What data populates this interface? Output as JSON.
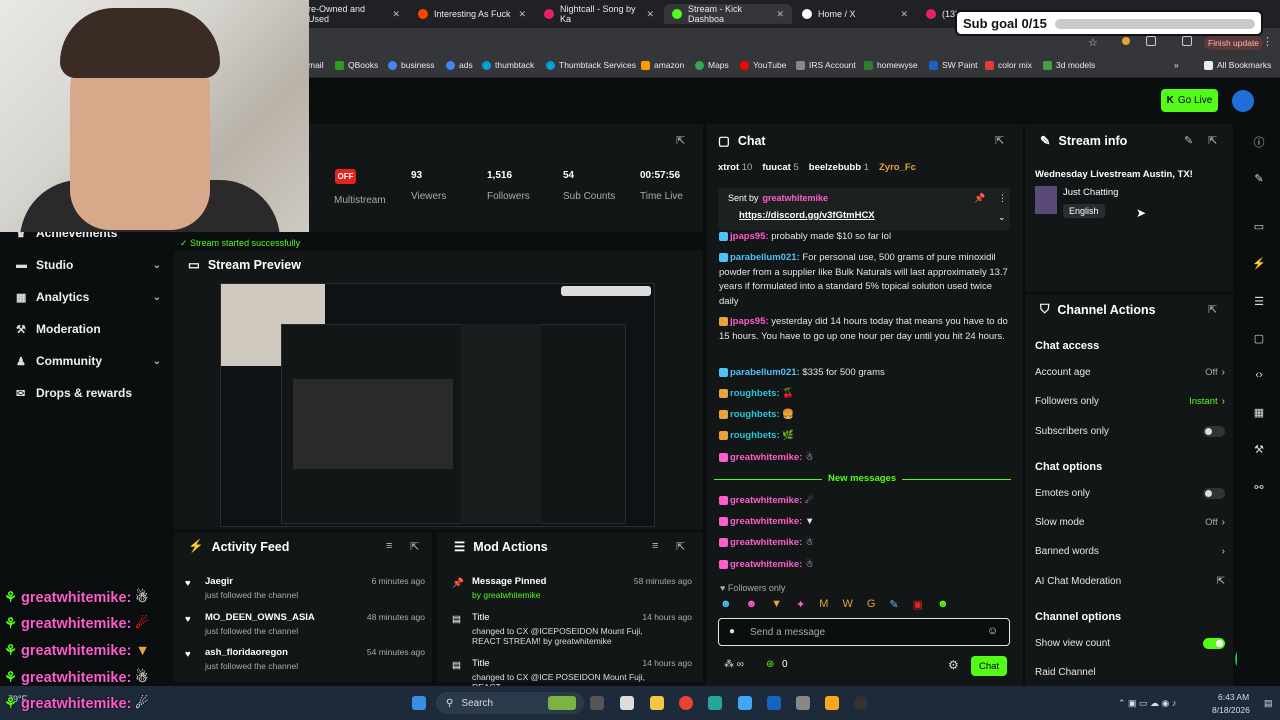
{
  "browser": {
    "tabs": [
      {
        "label": "re-Owned and Used",
        "color": "#5f6368"
      },
      {
        "label": "Interesting As Fuck",
        "color": "#ff4500"
      },
      {
        "label": "Nightcall - Song by Ka",
        "color": "#e91e63"
      },
      {
        "label": "Stream - Kick Dashboa",
        "color": "#53fc18"
      },
      {
        "label": "Home / X",
        "color": "#ffffff"
      },
      {
        "label": "(13)",
        "color": "#e91e63"
      }
    ],
    "finish_update": "Finish update",
    "bookmarks": [
      {
        "label": "mail",
        "color": "#cccccc"
      },
      {
        "label": "QBooks",
        "color": "#2ca01c"
      },
      {
        "label": "business",
        "color": "#4285f4"
      },
      {
        "label": "ads",
        "color": "#4285f4"
      },
      {
        "label": "thumbtack",
        "color": "#009fd9"
      },
      {
        "label": "Thumbtack Services",
        "color": "#009fd9"
      },
      {
        "label": "amazon",
        "color": "#ff9900"
      },
      {
        "label": "Maps",
        "color": "#34a853"
      },
      {
        "label": "YouTube",
        "color": "#ff0000"
      },
      {
        "label": "IRS Account",
        "color": "#888888"
      },
      {
        "label": "homewyse",
        "color": "#2e7d32"
      },
      {
        "label": "SW Paint",
        "color": "#1565c0"
      },
      {
        "label": "color mix",
        "color": "#e53935"
      },
      {
        "label": "3d models",
        "color": "#43a047"
      }
    ],
    "all_bookmarks": "All Bookmarks"
  },
  "header": {
    "go_live": "Go Live"
  },
  "overlay": {
    "sub_goal": "Sub goal 0/15",
    "sub_goal_progress": 0,
    "chat_lines": [
      {
        "user": "greatwhitemike:",
        "emote": "☃"
      },
      {
        "user": "greatwhitemike:",
        "emote": "☄"
      },
      {
        "user": "greatwhitemike:",
        "emote": "▼"
      },
      {
        "user": "greatwhitemike:",
        "emote": "☃"
      },
      {
        "user": "greatwhitemike:",
        "emote": "☄"
      }
    ]
  },
  "sidebar": {
    "items": [
      {
        "label": "Achievements",
        "icon": "trophy-icon",
        "has_chevron": false
      },
      {
        "label": "Studio",
        "icon": "studio-icon",
        "has_chevron": true
      },
      {
        "label": "Analytics",
        "icon": "chart-icon",
        "has_chevron": true
      },
      {
        "label": "Moderation",
        "icon": "shield-icon",
        "has_chevron": false
      },
      {
        "label": "Community",
        "icon": "people-icon",
        "has_chevron": true
      },
      {
        "label": "Drops & rewards",
        "icon": "gift-icon",
        "has_chevron": false
      }
    ],
    "toast": "Stream started successfully"
  },
  "stats": {
    "status": "OFF",
    "multistream": "Multistream",
    "items": [
      {
        "value": "93",
        "label": "Viewers"
      },
      {
        "value": "1,516",
        "label": "Followers"
      },
      {
        "value": "54",
        "label": "Sub Counts"
      },
      {
        "value": "00:57:56",
        "label": "Time Live"
      }
    ]
  },
  "preview": {
    "title": "Stream Preview"
  },
  "activity_feed": {
    "title": "Activity Feed",
    "items": [
      {
        "name": "Jaegir",
        "sub": "just followed the channel",
        "time": "6 minutes ago"
      },
      {
        "name": "MO_DEEN_OWNS_ASIA",
        "sub": "just followed the channel",
        "time": "48 minutes ago"
      },
      {
        "name": "ash_floridaoregon",
        "sub": "just followed the channel",
        "time": "54 minutes ago"
      }
    ]
  },
  "mod_actions": {
    "title": "Mod Actions",
    "items": [
      {
        "name": "Message Pinned",
        "sub": "by greatwhitemike",
        "time": "58 minutes ago"
      },
      {
        "name": "Title",
        "sub": "changed to CX @ICEPOSEIDON Mount Fuji, REACT STREAM! by greatwhitemike",
        "time": "14 hours ago"
      },
      {
        "name": "Title",
        "sub": "changed to CX @ICE POSEIDON Mount Fuji, REACT",
        "time": "14 hours ago"
      }
    ]
  },
  "chat": {
    "title": "Chat",
    "top_gifters": [
      {
        "name": "xtrot",
        "count": "10"
      },
      {
        "name": "fuucat",
        "count": "5"
      },
      {
        "name": "beelzebubb",
        "count": "1"
      },
      {
        "name": "Zyro_Fc",
        "count": ""
      }
    ],
    "pinned": {
      "sent_by_label": "Sent by",
      "user": "greatwhitemike",
      "link": "https://discord.gg/v3fGtmHCX"
    },
    "messages": [
      {
        "user": "jpaps95:",
        "text": "probably made $10 so far lol",
        "color": "pink"
      },
      {
        "user": "parabellum021:",
        "text": "For personal use, 500 grams of pure minoxidil powder from a supplier like Bulk Naturals will last approximately 13.7 years if formulated into a standard 5% topical solution used twice daily",
        "color": "blue"
      },
      {
        "user": "jpaps95:",
        "text": "yesterday did 14 hours today that means you have to do 15 hours. You have to go up one hour per day until you hit 24 hours.",
        "color": "pink"
      },
      {
        "user": "parabellum021:",
        "text": "$335 for 500 grams",
        "color": "blue"
      },
      {
        "user": "roughbets:",
        "text": "🍒",
        "color": "cyan"
      },
      {
        "user": "roughbets:",
        "text": "🍔",
        "color": "cyan"
      },
      {
        "user": "roughbets:",
        "text": "🌿",
        "color": "cyan"
      },
      {
        "user": "greatwhitemike:",
        "text": "☃",
        "color": "green"
      }
    ],
    "new_messages": "New messages",
    "new_msgs": [
      {
        "user": "greatwhitemike:",
        "text": "☄"
      },
      {
        "user": "greatwhitemike:",
        "text": "▼"
      },
      {
        "user": "greatwhitemike:",
        "text": "☃"
      },
      {
        "user": "greatwhitemike:",
        "text": "☃"
      }
    ],
    "followers_only": "Followers only",
    "send_placeholder": "Send a message",
    "points": "0",
    "chat_button": "Chat"
  },
  "stream_info": {
    "title": "Stream info",
    "stream_title": "Wednesday Livestream Austin, TX!",
    "category": "Just Chatting",
    "language": "English"
  },
  "channel_actions": {
    "title": "Channel Actions",
    "chat_access": "Chat access",
    "account_age": {
      "label": "Account age",
      "value": "Off"
    },
    "followers_only": {
      "label": "Followers only",
      "value": "Instant"
    },
    "subscribers_only": {
      "label": "Subscribers only"
    },
    "chat_options": "Chat options",
    "emotes_only": {
      "label": "Emotes only"
    },
    "slow_mode": {
      "label": "Slow mode",
      "value": "Off"
    },
    "banned_words": {
      "label": "Banned words"
    },
    "ai_moderation": {
      "label": "AI Chat Moderation"
    },
    "channel_options": "Channel options",
    "show_view_count": {
      "label": "Show view count"
    },
    "raid_channel": {
      "label": "Raid Channel"
    }
  },
  "taskbar": {
    "search": "Search",
    "time": "6:43 AM",
    "date": "8/18/2026",
    "weather": "79°F"
  },
  "colors": {
    "accent": "#53fc18",
    "panel": "#131617",
    "bg": "#0b0e0f"
  }
}
